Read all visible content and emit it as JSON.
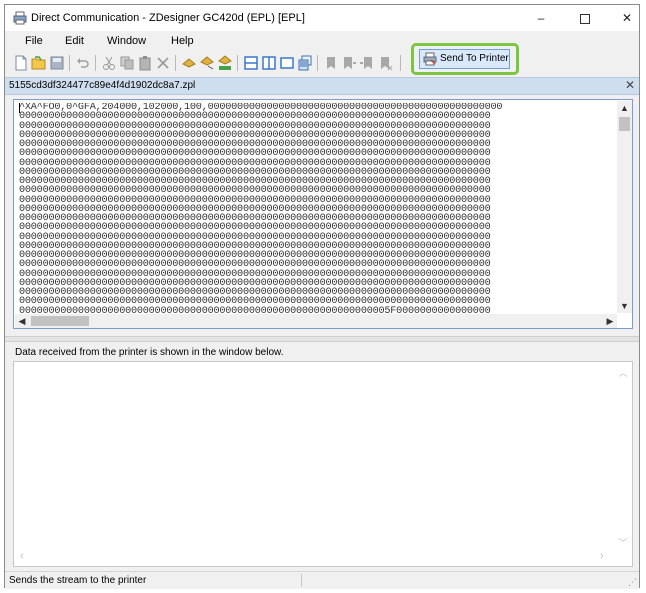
{
  "window": {
    "title": "Direct Communication - ZDesigner GC420d (EPL) [EPL]",
    "min_glyph": "–",
    "close_glyph": "✕"
  },
  "menu": {
    "items": [
      "File",
      "Edit",
      "Window",
      "Help"
    ]
  },
  "toolbar": {
    "send_label": "Send To Printer",
    "highlight_color": "#7dc443"
  },
  "document": {
    "filename": "5155cd3df324477c89e4f4d1902dc8a7.zpl",
    "close_glyph": "✕",
    "lines": [
      "^XA^FO0,0^GFA,204000,102000,100,00000000000000000000000000000000000000000000000000",
      "00000000000000000000000000000000000000000000000000000000000000000000000000000000",
      "00000000000000000000000000000000000000000000000000000000000000000000000000000000",
      "00000000000000000000000000000000000000000000000000000000000000000000000000000000",
      "00000000000000000000000000000000000000000000000000000000000000000000000000000000",
      "00000000000000000000000000000000000000000000000000000000000000000000000000000000",
      "00000000000000000000000000000000000000000000000000000000000000000000000000000000",
      "00000000000000000000000000000000000000000000000000000000000000000000000000000000",
      "00000000000000000000000000000000000000000000000000000000000000000000000000000000",
      "00000000000000000000000000000000000000000000000000000000000000000000000000000000",
      "00000000000000000000000000000000000000000000000000000000000000000000000000000000",
      "00000000000000000000000000000000000000000000000000000000000000000000000000000000",
      "00000000000000000000000000000000000000000000000000000000000000000000000000000000",
      "00000000000000000000000000000000000000000000000000000000000000000000000000000000",
      "00000000000000000000000000000000000000000000000000000000000000000000000000000000",
      "00000000000000000000000000000000000000000000000000000000000000000000000000000000",
      "00000000000000000000000000000000000000000000000000000000000000000000000000000000",
      "00000000000000000000000000000000000000000000000000000000000000000000000000000000",
      "00000000000000000000000000000000000000000000000000000000000000000000000000000000",
      "00000000000000000000000000000000000000000000000000000000000000000000000000000000",
      "00000000000000000000000000000000000000000000000000000000000000000000000000000000",
      "00000000000000000000000000000000000000000000000000000000000000000000000000000000",
      "000000000000000000000000000000000000000000000000000000000000005F0000000000000000"
    ]
  },
  "received": {
    "label": "Data received from the printer is shown in the window below."
  },
  "status": {
    "text": "Sends the stream to the printer"
  }
}
